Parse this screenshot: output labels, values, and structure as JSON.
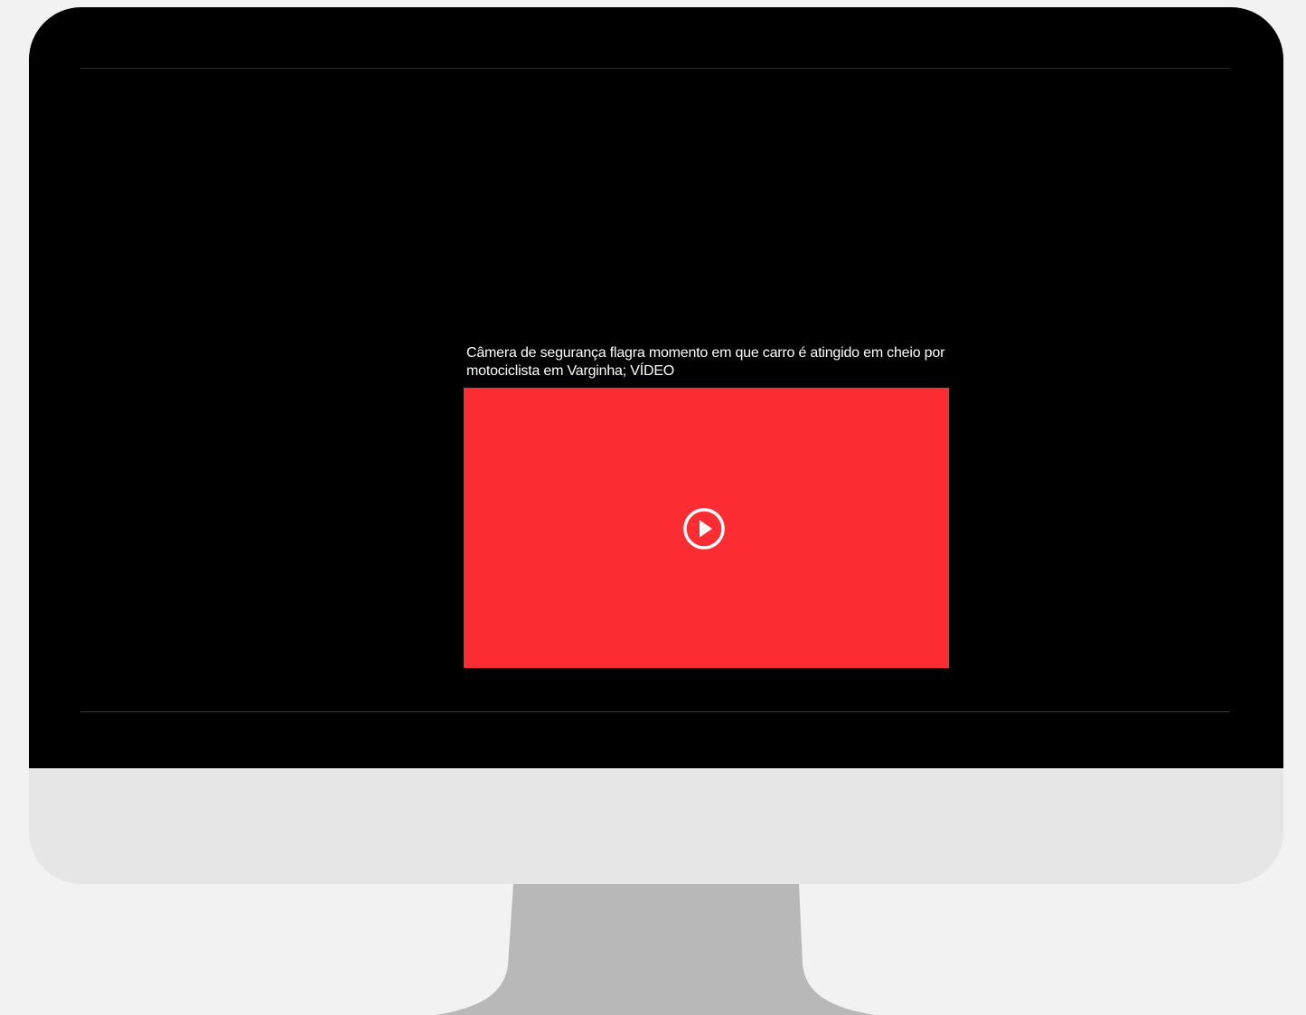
{
  "video": {
    "title": "Câmera de segurança flagra momento em que carro é atingido em cheio por motociclista em Varginha; VÍDEO",
    "play_icon": "play-circle-icon",
    "player_color": "#fb2d32"
  },
  "colors": {
    "screen": "#000000",
    "bezel_chin": "#e6e6e6",
    "stand": "#b8b8b8",
    "background": "#f2f2f2"
  }
}
